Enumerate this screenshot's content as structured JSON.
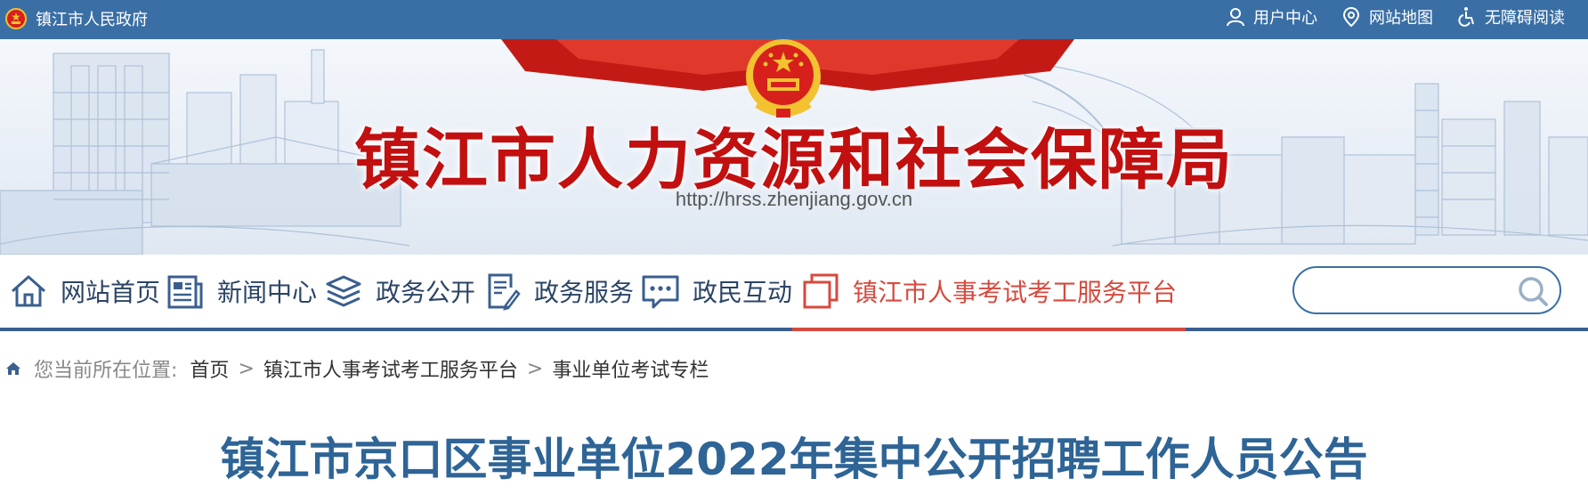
{
  "topbar": {
    "gov_label": "镇江市人民政府",
    "links": {
      "user_center": "用户中心",
      "site_map": "网站地图",
      "accessibility": "无障碍阅读"
    }
  },
  "banner": {
    "title": "镇江市人力资源和社会保障局",
    "url": "http://hrss.zhenjiang.gov.cn"
  },
  "nav": {
    "items": [
      {
        "label": "网站首页",
        "icon": "home-icon"
      },
      {
        "label": "新闻中心",
        "icon": "news-icon"
      },
      {
        "label": "政务公开",
        "icon": "layers-icon"
      },
      {
        "label": "政务服务",
        "icon": "document-edit-icon"
      },
      {
        "label": "政民互动",
        "icon": "chat-icon"
      },
      {
        "label": "镇江市人事考试考工服务平台",
        "icon": "copy-icon",
        "active": true
      }
    ],
    "search": {
      "placeholder": "",
      "value": ""
    }
  },
  "breadcrumb": {
    "prefix": "您当前所在位置:",
    "items": [
      "首页",
      "镇江市人事考试考工服务平台",
      "事业单位考试专栏"
    ],
    "separator": ">"
  },
  "article": {
    "title": "镇江市京口区事业单位2022年集中公开招聘工作人员公告"
  },
  "colors": {
    "topbar": "#3a6fa5",
    "title_red": "#c20f0f",
    "nav_text": "#2b4466",
    "active": "#d64a3e",
    "headline": "#2e6496"
  }
}
